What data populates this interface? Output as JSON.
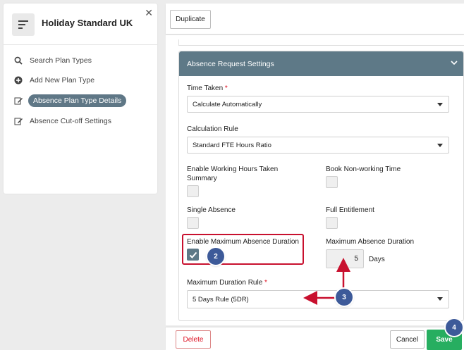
{
  "sidebar": {
    "title": "Holiday Standard UK",
    "items": [
      {
        "label": "Search Plan Types",
        "icon": "search-icon"
      },
      {
        "label": "Add New Plan Type",
        "icon": "plus-circle-icon"
      },
      {
        "label": "Absence Plan Type Details",
        "icon": "edit-icon",
        "active": true
      },
      {
        "label": "Absence Cut-off Settings",
        "icon": "edit-icon"
      }
    ]
  },
  "toolbar": {
    "duplicate_label": "Duplicate"
  },
  "section": {
    "title": "Absence Request Settings",
    "time_taken": {
      "label": "Time Taken",
      "value": "Calculate Automatically"
    },
    "calculation_rule": {
      "label": "Calculation Rule",
      "value": "Standard FTE Hours Ratio"
    },
    "enable_working_hours": {
      "label_line1": "Enable Working Hours Taken",
      "label_line2": "Summary",
      "checked": false
    },
    "book_non_working": {
      "label": "Book Non-working Time",
      "checked": false
    },
    "single_absence": {
      "label": "Single Absence",
      "checked": false
    },
    "full_entitlement": {
      "label": "Full Entitlement",
      "checked": false
    },
    "enable_max_duration": {
      "label": "Enable Maximum Absence Duration",
      "checked": true
    },
    "max_duration": {
      "label": "Maximum Absence Duration",
      "value": "5",
      "unit": "Days"
    },
    "max_duration_rule": {
      "label": "Maximum Duration Rule",
      "value": "5 Days Rule (5DR)"
    },
    "required_mark": "*"
  },
  "footer": {
    "delete_label": "Delete",
    "cancel_label": "Cancel",
    "save_label": "Save"
  },
  "annotations": {
    "m2": "2",
    "m3": "3",
    "m4": "4"
  },
  "colors": {
    "header": "#5e7987",
    "save": "#27ae60",
    "highlight": "#c8102e",
    "marker": "#3d5a99"
  }
}
